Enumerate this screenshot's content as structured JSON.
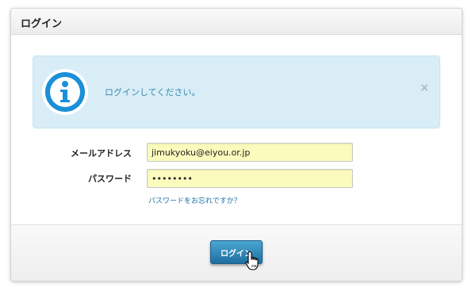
{
  "panel": {
    "title": "ログイン"
  },
  "alert": {
    "message": "ログインしてください。",
    "close_glyph": "×",
    "icon": "info-icon",
    "color": "#3a87ad",
    "background": "#d9edf7"
  },
  "form": {
    "email_label": "メールアドレス",
    "email_value": "jimukyoku@eiyou.or.jp",
    "password_label": "パスワード",
    "password_value": "••••••••",
    "forgot_link": "パスワードをお忘れですか？"
  },
  "footer": {
    "login_button": "ログイン",
    "button_color": "#2b88bd"
  },
  "cursor": "hand-pointer-icon"
}
